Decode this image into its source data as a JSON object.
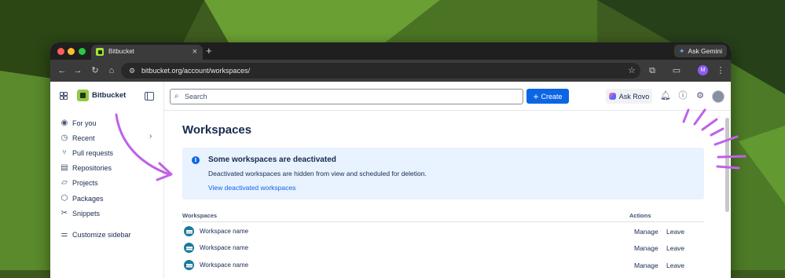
{
  "browser": {
    "tab_title": "Bitbucket",
    "tab_close": "×",
    "new_tab": "+",
    "url": "bitbucket.org/account/workspaces/",
    "ask_gemini": "Ask Gemini",
    "profile_initial": "M"
  },
  "header": {
    "brand": "Bitbucket",
    "search_placeholder": "Search",
    "create_label": "Create",
    "ask_rovo_label": "Ask Rovo"
  },
  "sidebar": {
    "items": [
      {
        "label": "For you",
        "icon": "person-circle-icon"
      },
      {
        "label": "Recent",
        "icon": "clock-icon"
      },
      {
        "label": "Pull requests",
        "icon": "pull-request-icon"
      },
      {
        "label": "Repositories",
        "icon": "repository-icon"
      },
      {
        "label": "Projects",
        "icon": "folder-icon"
      },
      {
        "label": "Packages",
        "icon": "package-icon"
      },
      {
        "label": "Snippets",
        "icon": "scissors-icon"
      }
    ],
    "customize_label": "Customize sidebar"
  },
  "main": {
    "title": "Workspaces",
    "banner": {
      "title": "Some workspaces are deactivated",
      "body": "Deactivated workspaces are hidden from view and scheduled for deletion.",
      "link": "View deactivated workspaces"
    },
    "table": {
      "col_workspaces": "Workspaces",
      "col_actions": "Actions",
      "rows": [
        {
          "name": "Workspace name",
          "manage": "Manage",
          "leave": "Leave"
        },
        {
          "name": "Workspace name",
          "manage": "Manage",
          "leave": "Leave"
        },
        {
          "name": "Workspace name",
          "manage": "Manage",
          "leave": "Leave"
        }
      ]
    }
  },
  "colors": {
    "accent": "#0c66e4",
    "banner_bg": "#e9f2ff",
    "annotation": "#c061e8"
  }
}
